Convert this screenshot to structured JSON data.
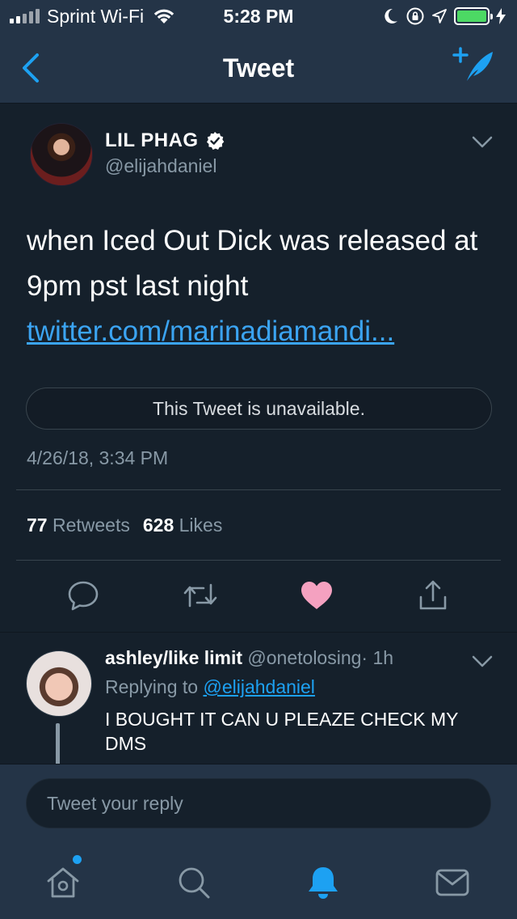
{
  "status_bar": {
    "carrier": "Sprint Wi-Fi",
    "time": "5:28 PM",
    "battery_color": "#4cd964"
  },
  "nav": {
    "title": "Tweet",
    "back_icon": "chevron-left-icon",
    "compose_icon": "compose-tweet-icon"
  },
  "tweet": {
    "display_name": "LIL PHAG",
    "handle": "@elijahdaniel",
    "verified": true,
    "text": "when Iced Out Dick was released at 9pm pst last night",
    "link": "twitter.com/marinadiamandi...",
    "quote_notice": "This Tweet is unavailable.",
    "timestamp": "4/26/18, 3:34 PM",
    "retweets_count": "77",
    "retweets_label": "Retweets",
    "likes_count": "628",
    "likes_label": "Likes",
    "liked": true,
    "like_color": "#f4a1c0"
  },
  "reply": {
    "display_name": "ashley/like limit",
    "handle": "@onetolosing",
    "age": "· 1h",
    "replying_prefix": "Replying to",
    "replying_to": "@elijahdaniel",
    "text": "I BOUGHT IT CAN U PLEAZE CHECK MY DMS"
  },
  "composer": {
    "placeholder": "Tweet your reply"
  },
  "tabs": [
    {
      "icon": "home-icon"
    },
    {
      "icon": "search-icon"
    },
    {
      "icon": "notifications-icon",
      "active": true
    },
    {
      "icon": "messages-icon"
    }
  ],
  "colors": {
    "accent": "#1da1f2",
    "background": "#15202b",
    "bar": "#243447",
    "secondary_text": "#8899a6"
  }
}
